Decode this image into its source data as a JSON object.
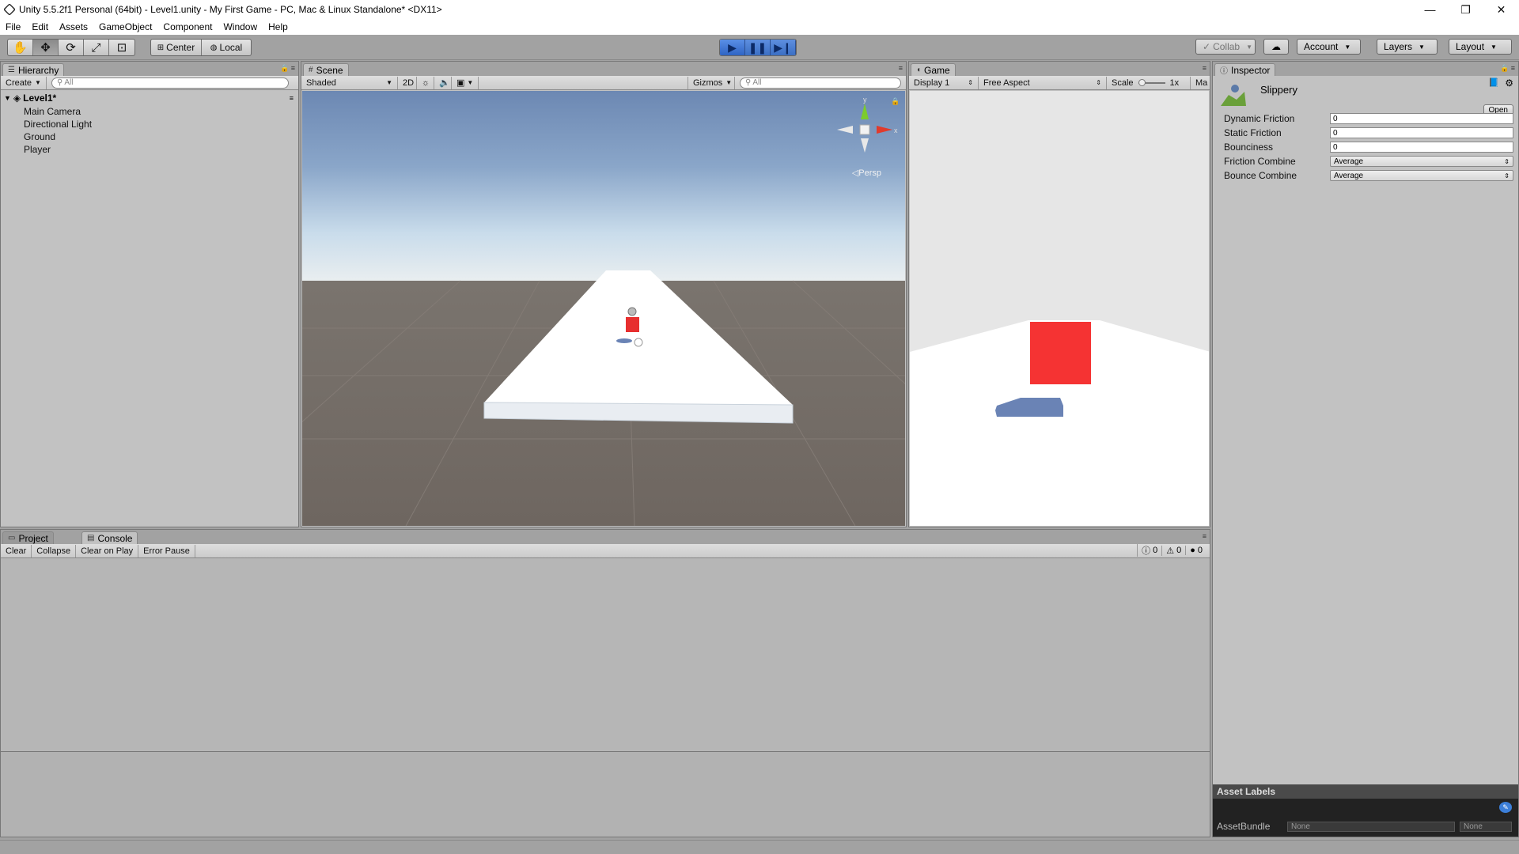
{
  "window": {
    "title": "Unity 5.5.2f1 Personal (64bit) - Level1.unity - My First Game - PC, Mac & Linux Standalone* <DX11>",
    "minimize": "—",
    "maximize": "❐",
    "close": "✕"
  },
  "menu": [
    "File",
    "Edit",
    "Assets",
    "GameObject",
    "Component",
    "Window",
    "Help"
  ],
  "toolbar": {
    "tools": [
      "hand-icon",
      "move-icon",
      "rotate-icon",
      "scale-icon",
      "rect-icon"
    ],
    "pivot": "Center",
    "space": "Local",
    "collab": "Collab",
    "account": "Account",
    "layers": "Layers",
    "layout": "Layout"
  },
  "hierarchy": {
    "tab": "Hierarchy",
    "create": "Create",
    "search_placeholder": "All",
    "scene": "Level1*",
    "items": [
      "Main Camera",
      "Directional Light",
      "Ground",
      "Player"
    ]
  },
  "scene": {
    "tab": "Scene",
    "shading": "Shaded",
    "mode_2d": "2D",
    "gizmos": "Gizmos",
    "search_placeholder": "All",
    "persp": "Persp",
    "axis_x": "x",
    "axis_y": "y"
  },
  "game": {
    "tab": "Game",
    "display": "Display 1",
    "aspect": "Free Aspect",
    "scale_label": "Scale",
    "scale_value": "1x",
    "maximize": "Ma"
  },
  "inspector": {
    "tab": "Inspector",
    "asset_name": "Slippery",
    "open_button": "Open",
    "properties": [
      {
        "label": "Dynamic Friction",
        "value": "0"
      },
      {
        "label": "Static Friction",
        "value": "0"
      },
      {
        "label": "Bounciness",
        "value": "0"
      },
      {
        "label": "Friction Combine",
        "value": "Average"
      },
      {
        "label": "Bounce Combine",
        "value": "Average"
      }
    ],
    "asset_labels": "Asset Labels",
    "asset_bundle_label": "AssetBundle",
    "asset_bundle_value": "None",
    "asset_variant_value": "None"
  },
  "console": {
    "tab_project": "Project",
    "tab_console": "Console",
    "buttons": [
      "Clear",
      "Collapse",
      "Clear on Play",
      "Error Pause"
    ],
    "info_count": "0",
    "warning_count": "0",
    "error_count": "0"
  },
  "colors": {
    "editor_bg": "#a2a2a2",
    "panel_bg": "#c2c2c2",
    "play_blue": "#3b6fc4",
    "player_red": "#f53333",
    "player_shadow": "#6a83b5"
  }
}
